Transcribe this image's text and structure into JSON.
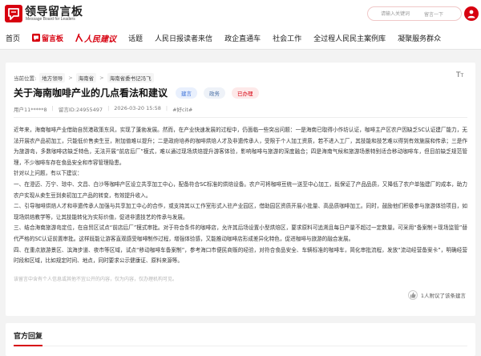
{
  "header": {
    "logo_title": "领导留言板",
    "logo_subtitle": "Message Board for Leaders",
    "search_placeholder": "请输入关键词",
    "search_button": "留言一下"
  },
  "nav": {
    "items": [
      "首页",
      "留言板",
      "人民建议",
      "话题",
      "人民日报读者来信",
      "政企直通车",
      "社会工作",
      "全过程人民民主案例库",
      "凝聚服务群众"
    ],
    "active": "留言板"
  },
  "breadcrumb": {
    "label": "当前位置:",
    "separator": ">",
    "items": [
      "地方领导",
      "海南省",
      "海南省委书记冯飞"
    ]
  },
  "post": {
    "title": "关于海南咖啡产业的几点看法和建议",
    "tags": [
      {
        "label": "建言",
        "color": "#3a6fd8",
        "bg": "#e9f0fd"
      },
      {
        "label": "政务",
        "color": "#4a6fa5",
        "bg": "#eef2f8"
      },
      {
        "label": "已办理",
        "color": "#d7000f",
        "bg": "#fde9e9"
      }
    ],
    "meta_separator": "|",
    "meta": [
      "用户11*****8",
      "留言ID:24955497",
      "2026-03-20 15:58",
      "#好cit#"
    ]
  },
  "content": {
    "paragraphs": [
      "近年来，海南咖啡产业借助自贸港政策东风，实现了蓬勃发展。然而，在产业快速发展的过程中，仍面临一些突出问题：一是海南已取得小作坊认证，咖啡主产区农户因缺乏SC认证建厂能力，无法开展农产品初加工，只能低价售卖生豆，附加值难以提升；二是政府培养的咖啡烘焙人才及非遗传承人，受限于个人加工资质，若不进入工厂，其技能和技艺难以得到有效施展和传承；三是作为旅游岛，多数咖啡店缺乏特色，无法开展“前店后厂”模式，难以通过现场烘焙提升游客体验，影响咖啡与旅游的深度融合；四是海南气候和旅游场景特别适合移动咖啡车，但目前缺乏规范管理，不少咖啡车存在食品安全和市容管理隐患。",
      "针对以上问题，有以下建议：",
      "一、在澄迈、万宁、琼中、文昌、白沙等咖啡产区设立共享加工中心，配备符合SC标准的烘焙设备。农户可将咖啡豆统一送至中心加工，既保证了产品品质，又降低了农户单独建厂的成本，助力农户实现从卖生豆到卖初加工产品的转变，有效提升收入。",
      "二、引导咖啡烘焙人才和非遗传承人加强与共享加工中心的合作，或支持其以工作室形式入驻产业园区，借助园区资质开展小批量、高品质咖啡加工。同时，鼓励他们积极参与旅游体验项目，如现场烘焙教学等，让其技能转化为实际价值，促进非遗技艺的传承与发展。",
      "三、结合海南旅游岛定位，在自贸区试点“前店后厂”模式审批。对于符合条件的咖啡店，允许其后场设置小型烘焙区，要求原料可追溯且每日产量不超过一定数量。可采用“备案制＋现场监管”替代严格的SC认证前置审批。这样既能让游客直观感受咖啡制作过程，增强体验感，又能推动咖啡店形成差异化特色，促进咖啡与旅游的融合发展。",
      "四、在重点旅游景区、滨海步道、夜市等区域，试点“移动咖啡车备案制”，参考海口市便民商贩的经验，对符合食品安全、车辆标准的咖啡车，简化审批流程，发放“流动经营备案卡”，明确经营时段和区域，比如规定时间、地点，同时要求公示健康证、原料来源等。"
    ],
    "note": "该留言中含有个人信息或其他不宜公开的内容，仅为内容，仅办理机构可见。",
    "support_text": "1人附议了该条建言"
  },
  "reply": {
    "title": "官方回复"
  },
  "icons": {
    "logo": "message-board-logo-icon",
    "user": "user-avatar-icon",
    "board": "message-board-icon",
    "suggestion": "people-suggestion-icon",
    "font_size": "font-size-icon",
    "support": "thumbs-up-icon"
  },
  "colors": {
    "brand": "#d7000f",
    "page_bg": "#f3f3f3",
    "card_bg": "#ffffff",
    "text": "#333333"
  }
}
